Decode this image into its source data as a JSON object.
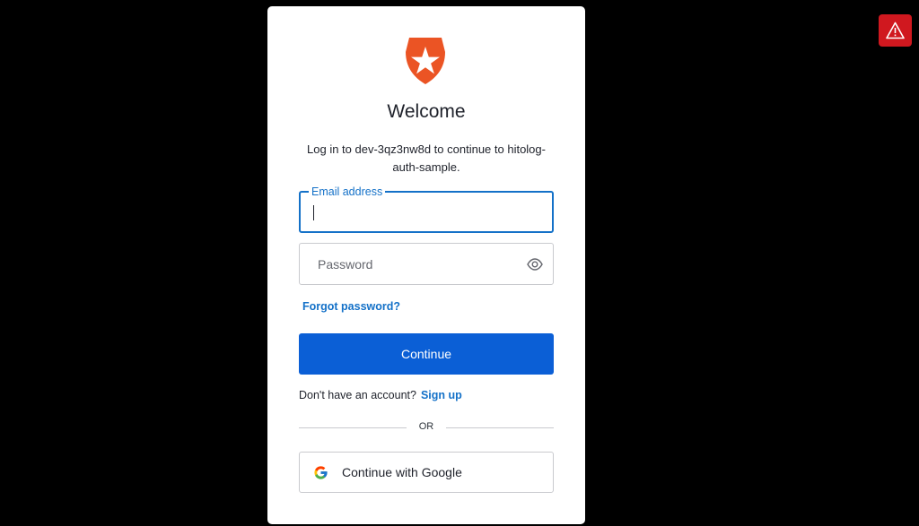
{
  "card": {
    "title": "Welcome",
    "subtitle": "Log in to dev-3qz3nw8d to continue to hitolog-auth-sample."
  },
  "email": {
    "label": "Email address",
    "value": ""
  },
  "password": {
    "placeholder": "Password",
    "toggle_icon": "eye-icon"
  },
  "links": {
    "forgot_password": "Forgot password?",
    "no_account": "Don't have an account?",
    "sign_up": "Sign up"
  },
  "buttons": {
    "continue": "Continue",
    "google": "Continue with Google"
  },
  "divider": {
    "text": "OR"
  },
  "icons": {
    "logo": "auth0-shield-star-icon",
    "google": "google-g-icon",
    "warning": "warning-triangle-icon"
  },
  "colors": {
    "primary_button": "#0b5fd6",
    "link": "#1471c8",
    "logo": "#eb5424",
    "warning_badge": "#d0181f",
    "background": "#000000"
  }
}
